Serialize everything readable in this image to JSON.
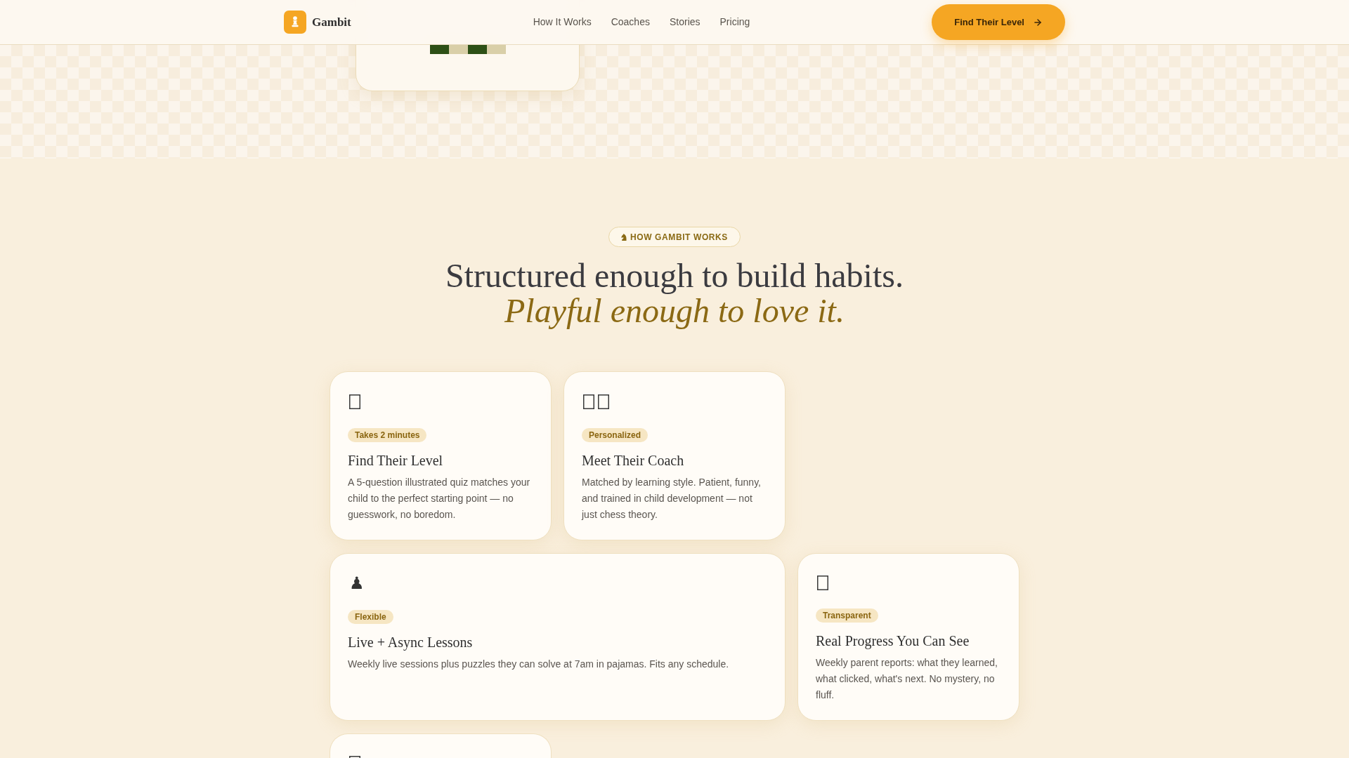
{
  "header": {
    "brand": "Gambit",
    "nav_links": [
      "How It Works",
      "Coaches",
      "Stories",
      "Pricing"
    ],
    "cta_button": "Find Their Level"
  },
  "how_it_works": {
    "eyebrow": "HOW GAMBIT WORKS",
    "heading": "Structured enough to build habits.",
    "heading_accent": "Playful enough to love it.",
    "cards": [
      {
        "icons": [
          {
            "kind": "box"
          }
        ],
        "tag": "Takes 2 minutes",
        "title": "Find Their Level",
        "description": "A 5-question illustrated quiz matches your child to the perfect starting point — no guesswork, no boredom."
      },
      {
        "icons": [
          {
            "kind": "box"
          },
          {
            "kind": "box"
          }
        ],
        "tag": "Personalized",
        "title": "Meet Their Coach",
        "description": "Matched by learning style. Patient, funny, and trained in child development — not just chess theory."
      },
      {
        "icons": [
          {
            "kind": "glyph",
            "text": "♟"
          }
        ],
        "tag": "Flexible",
        "title": "Live + Async Lessons",
        "description": "Weekly live sessions plus puzzles they can solve at 7am in pajamas. Fits any schedule."
      },
      {
        "icons": [
          {
            "kind": "box"
          }
        ],
        "tag": "Transparent",
        "title": "Real Progress You Can See",
        "description": "Weekly parent reports: what they learned, what clicked, what's next. No mystery, no fluff."
      },
      {
        "icons": [
          {
            "kind": "box"
          }
        ]
      }
    ]
  }
}
